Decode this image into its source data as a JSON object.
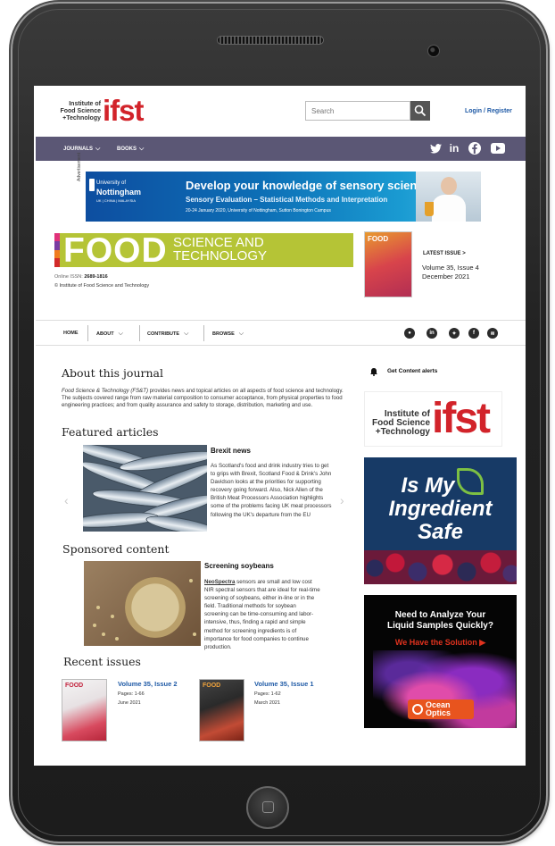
{
  "header": {
    "logo_text_line1": "Institute of",
    "logo_text_line2": "Food Science",
    "logo_text_line3": "+Technology",
    "logo_mark": "ifst",
    "search_placeholder": "Search",
    "login_label": "Login / Register"
  },
  "top_nav": {
    "journals": "JOURNALS",
    "books": "BOOKS",
    "social_icons": [
      "twitter-icon",
      "linkedin-icon",
      "facebook-icon",
      "youtube-icon"
    ]
  },
  "ad_banner": {
    "label": "Advertisement",
    "university_line1": "University of",
    "university_line2": "Nottingham",
    "university_line3": "UK | CHINA | MALAYSIA",
    "headline": "Develop your knowledge of sensory science",
    "subheadline": "Sensory Evaluation – Statistical Methods and Interpretation",
    "details": "20-24 January 2020, University of Nottingham, Sutton Bonington Campus"
  },
  "journal": {
    "masthead_big": "FOOD",
    "masthead_line1": "SCIENCE AND",
    "masthead_line2": "TECHNOLOGY",
    "issn_label": "Online ISSN:",
    "issn_value": "2689-1816",
    "copyright": "© Institute of Food Science and Technology",
    "cover_title": "FOOD",
    "latest_issue_label": "LATEST ISSUE  >",
    "latest_issue_volume": "Volume 35, Issue 4",
    "latest_issue_date": "December 2021"
  },
  "secondary_nav": {
    "home": "HOME",
    "about": "ABOUT",
    "contribute": "CONTRIBUTE",
    "browse": "BROWSE",
    "icons": [
      "bell-icon",
      "linkedin-icon",
      "twitter-icon",
      "facebook-icon",
      "rss-icon"
    ]
  },
  "about": {
    "heading": "About this journal",
    "journal_name": "Food Science & Technology (FS&T)",
    "text": " provides news and topical articles on all aspects of food science and technology. The subjects covered range from raw material composition to consumer acceptance, from physical properties to food engineering practices; and from quality assurance and safety to storage, distribution, marketing and use."
  },
  "featured": {
    "heading": "Featured articles",
    "title": "Brexit news",
    "text": "As Scotland's food and drink industry tries to get to grips with Brexit, Scotland Food & Drink's John Davidson looks at the priorities for supporting recovery going forward. Also, Nick Allen of the British Meat Processors Association highlights some of the problems facing UK meat processors following the UK's departure from the EU",
    "prev_arrow": "‹",
    "next_arrow": "›"
  },
  "sponsored": {
    "heading": "Sponsored content",
    "title": "Screening soybeans",
    "brand": "NeoSpectra",
    "text": " sensors are small and low cost NIR spectral sensors that are ideal for real-time screening of soybeans, either in-line or in the field. Traditional methods for soybean screening can be time-consuming and labor-intensive, thus, finding a rapid and simple method for screening ingredients is of importance for food companies to continue production."
  },
  "recent": {
    "heading": "Recent issues",
    "issues": [
      {
        "cover_title": "FOOD",
        "volume": "Volume 35, Issue 2",
        "pages": "Pages:  1-66",
        "date": "June 2021"
      },
      {
        "cover_title": "FOOD",
        "volume": "Volume 35, Issue 1",
        "pages": "Pages:  1-62",
        "date": "March 2021"
      }
    ]
  },
  "sidebar": {
    "alerts_label": "Get Content alerts",
    "logo_text_line1": "Institute of",
    "logo_text_line2": "Food Science",
    "logo_text_line3": "+Technology",
    "logo_mark": "ifst",
    "ad1_line1": "Is My",
    "ad1_line2": "Ingredient",
    "ad1_line3": "Safe",
    "ad2_line1": "Need to Analyze Your",
    "ad2_line2": "Liquid Samples Quickly?",
    "ad2_solution": "We Have the Solution ▶",
    "ad2_brand_line1": "Ocean",
    "ad2_brand_line2": "Optics"
  },
  "colors": {
    "ifst_red": "#d2232a",
    "nav_purple": "#5b5775",
    "food_green": "#b5c436",
    "link_blue": "#1f5aa6"
  }
}
